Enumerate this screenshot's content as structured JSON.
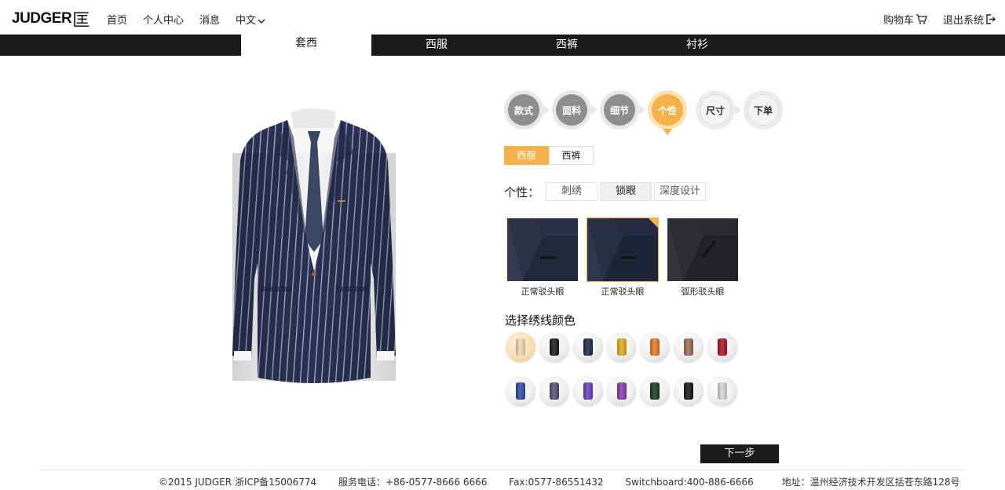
{
  "header": {
    "logo_text": "JUDGER",
    "logo_glyph": "匡",
    "nav": [
      "首页",
      "个人中心",
      "消息"
    ],
    "language": "中文",
    "cart": "购物车",
    "logout": "退出系统"
  },
  "categories": {
    "items": [
      "套西",
      "西服",
      "西裤",
      "衬衫"
    ],
    "active": "套西"
  },
  "steps": {
    "items": [
      "款式",
      "面料",
      "细节",
      "个性",
      "尺寸",
      "下单"
    ],
    "current": "个性"
  },
  "subtabs": {
    "items": [
      "西服",
      "西裤"
    ],
    "active": "西服"
  },
  "personalization": {
    "label": "个性：",
    "options": [
      "刺绣",
      "锁眼",
      "深度设计"
    ],
    "active": "锁眼"
  },
  "buttonholes": [
    {
      "caption": "正常驳头眼",
      "selected": false,
      "fabric": "#2b3048"
    },
    {
      "caption": "正常驳头眼",
      "selected": true,
      "fabric": "#262b45"
    },
    {
      "caption": "弧形驳头眼",
      "selected": false,
      "fabric": "#2a2b30"
    }
  ],
  "thread_colors": {
    "title": "选择绣线颜色",
    "rows": [
      [
        "#f2dcb8",
        "#1a1a1a",
        "#1d2a4a",
        "#e3b21c",
        "#ee7a22",
        "#9c6e58",
        "#b11426"
      ],
      [
        "#2a4fa6",
        "#5b4f7a",
        "#6c3fbf",
        "#8a3eb0",
        "#1e3a22",
        "#151515",
        "#d8d8d8"
      ]
    ]
  },
  "next_button": "下一步",
  "footer": {
    "copyright": "©2015 JUDGER 浙ICP备15006774",
    "service": "服务电话：+86-0577-8666 6666",
    "fax": "Fax:0577-86551432",
    "switchboard": "Switchboard:400-886-6666",
    "address": "地址：温州经济技术开发区括苍东路128号"
  },
  "colors": {
    "accent": "#f6b24a",
    "dark_bar": "#1a1a1a"
  }
}
